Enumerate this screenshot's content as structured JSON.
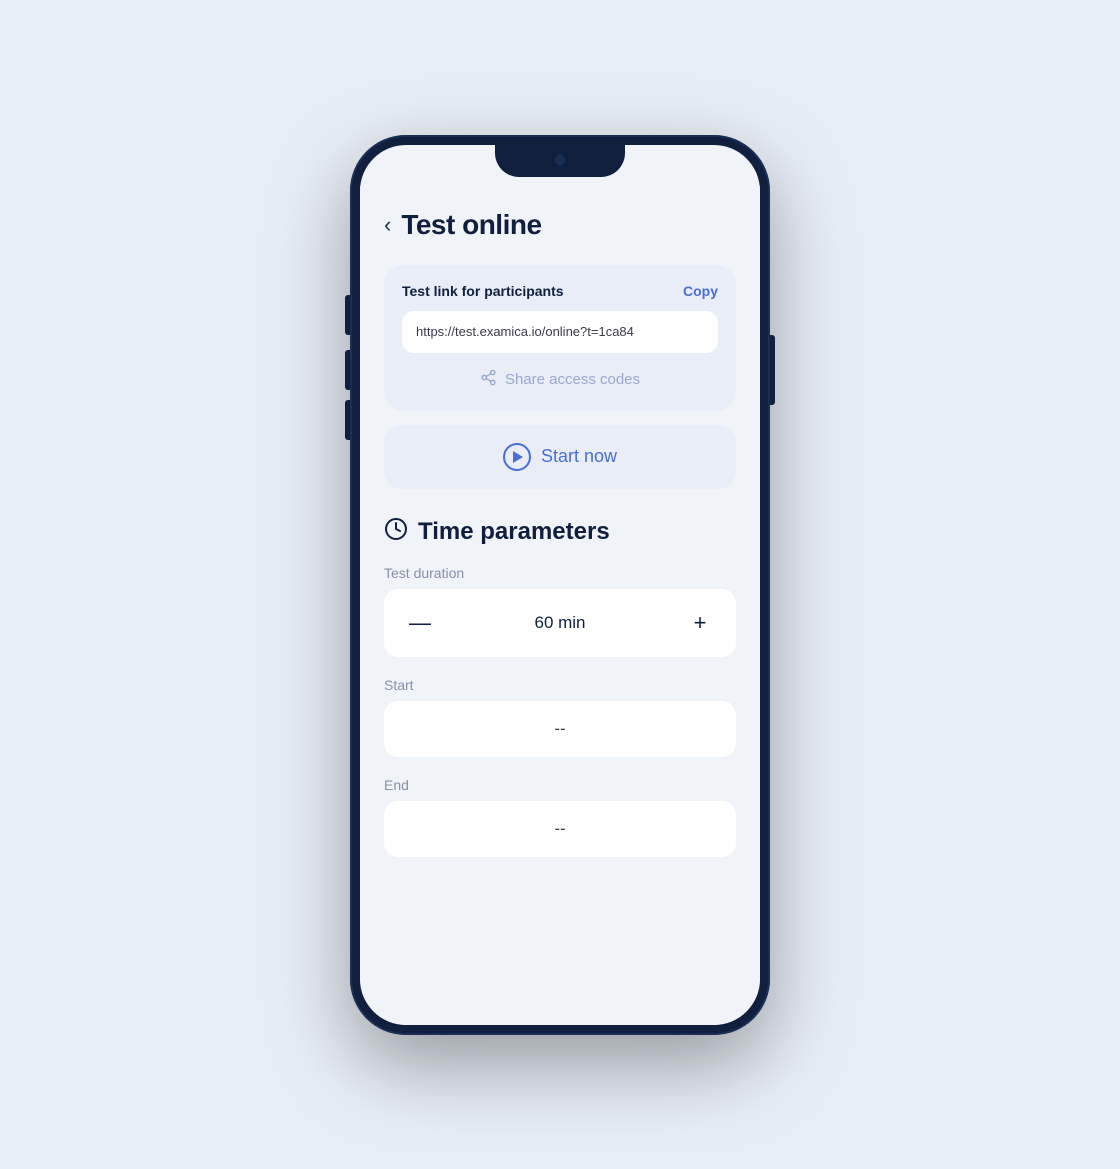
{
  "page": {
    "title": "Test online",
    "back_label": "<"
  },
  "test_link_card": {
    "label": "Test link for participants",
    "copy_label": "Copy",
    "link_url": "https://test.examica.io/online?t=1ca84",
    "share_codes_label": "Share access codes"
  },
  "start_now": {
    "label": "Start now"
  },
  "time_parameters": {
    "section_title": "Time parameters",
    "duration": {
      "label": "Test duration",
      "value": "60 min",
      "decrement": "—",
      "increment": "+"
    },
    "start": {
      "label": "Start",
      "placeholder": "--"
    },
    "end": {
      "label": "End",
      "placeholder": "--"
    }
  },
  "icons": {
    "back": "‹",
    "clock": "⊙",
    "share": "⤼",
    "play_circle": "play"
  }
}
